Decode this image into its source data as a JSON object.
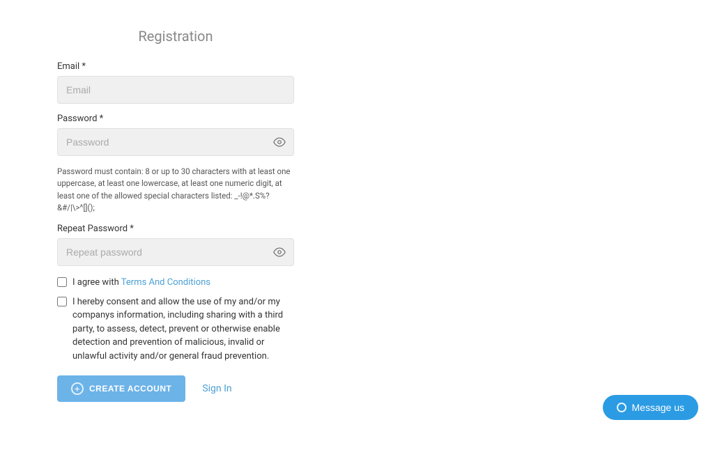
{
  "page": {
    "title": "Registration"
  },
  "form": {
    "email_label": "Email *",
    "email_placeholder": "Email",
    "password_label": "Password *",
    "password_placeholder": "Password",
    "password_hint": "Password must contain: 8 or up to 30 characters with at least one uppercase, at least one lowercase, at least one numeric digit, at least one of the allowed special characters listed: _-!@*.S%?&#/|\\>^[]();",
    "repeat_password_label": "Repeat Password *",
    "repeat_password_placeholder": "Repeat password",
    "checkbox1_label_prefix": "I agree with ",
    "checkbox1_link": "Terms And Conditions",
    "checkbox2_label": "I hereby consent and allow the use of my and/or my companys information, including sharing with a third party, to assess, detect, prevent or otherwise enable detection and prevention of malicious, invalid or unlawful activity and/or general fraud prevention.",
    "create_btn_label": "CREATE ACCOUNT",
    "sign_in_label": "Sign In"
  },
  "message_btn": {
    "label": "Message us"
  }
}
